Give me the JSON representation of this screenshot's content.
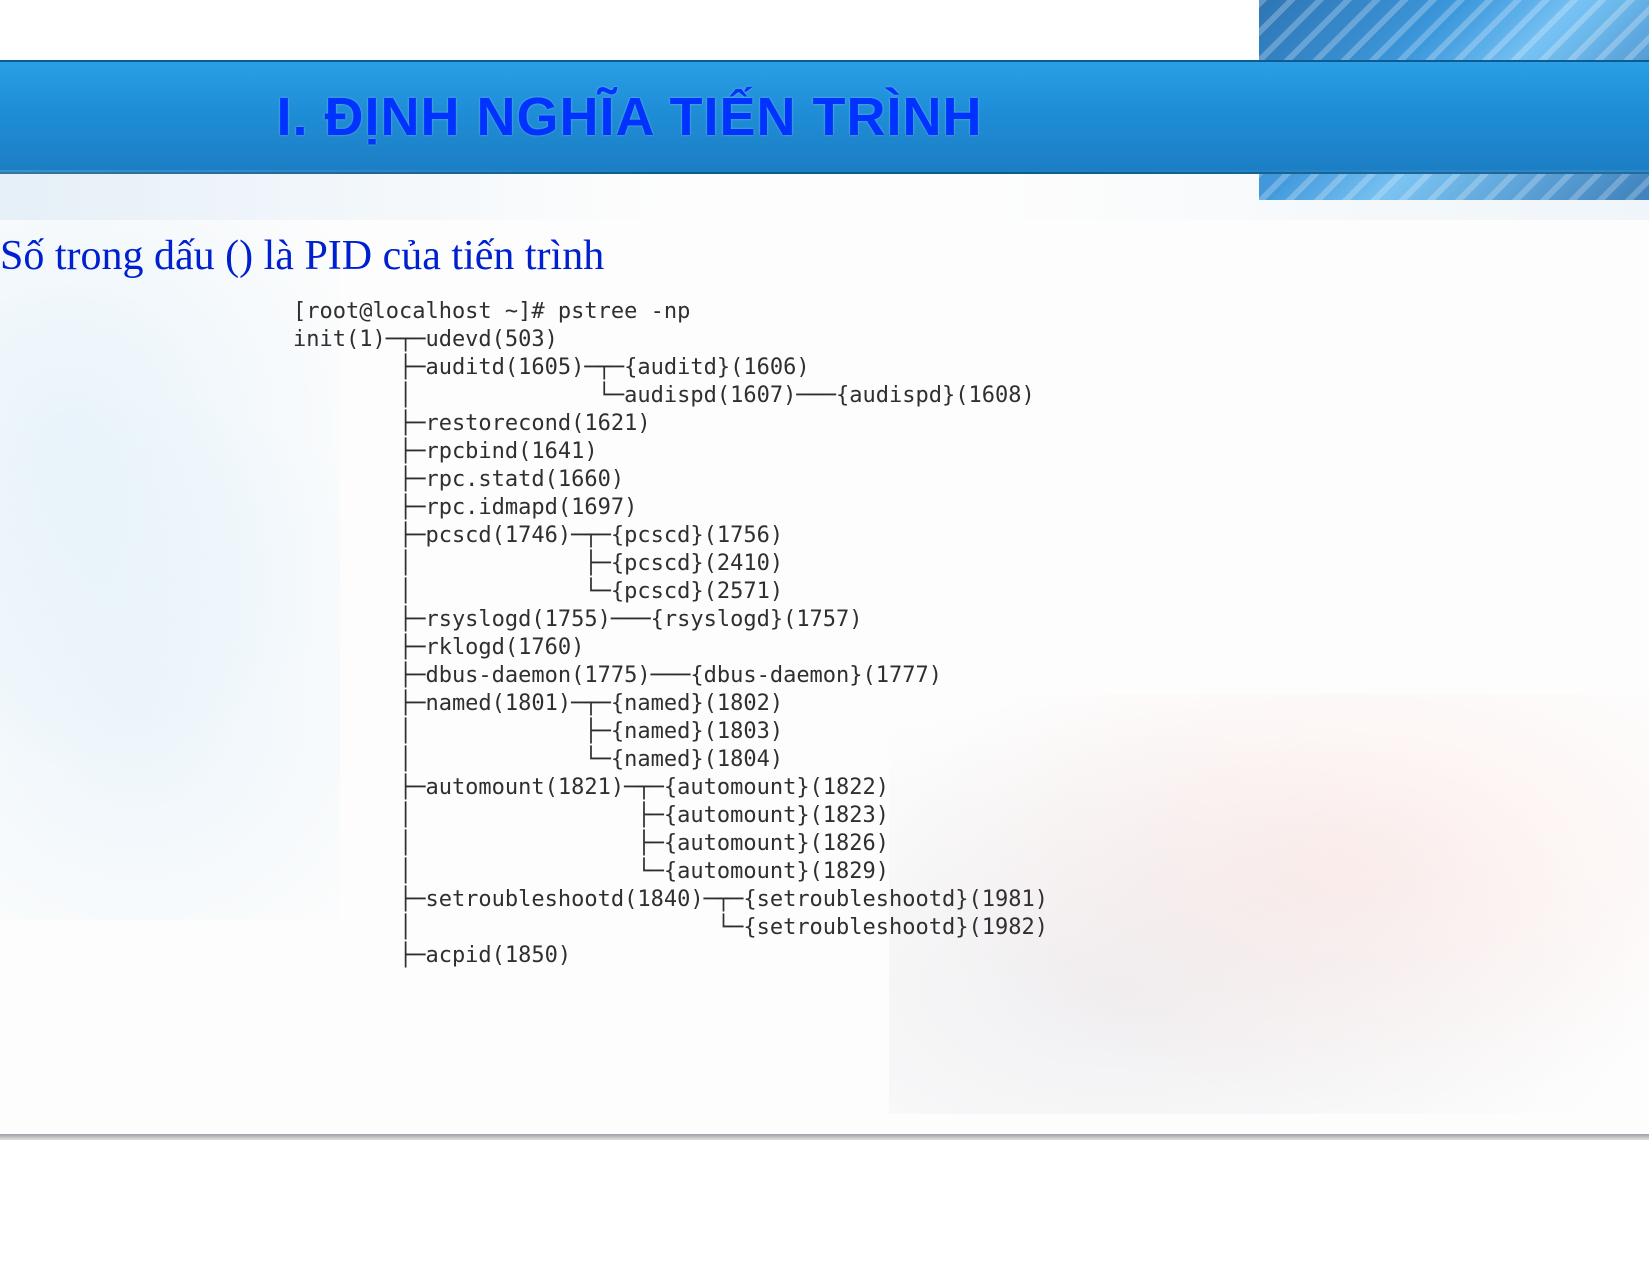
{
  "header": {
    "title": "I. ĐỊNH NGHĨA TIẾN TRÌNH"
  },
  "subtitle": "Số trong dấu () là PID của tiến trình",
  "terminal_output": "[root@localhost ~]# pstree -np\ninit(1)─┬─udevd(503)\n        ├─auditd(1605)─┬─{auditd}(1606)\n        │              └─audispd(1607)───{audispd}(1608)\n        ├─restorecond(1621)\n        ├─rpcbind(1641)\n        ├─rpc.statd(1660)\n        ├─rpc.idmapd(1697)\n        ├─pcscd(1746)─┬─{pcscd}(1756)\n        │             ├─{pcscd}(2410)\n        │             └─{pcscd}(2571)\n        ├─rsyslogd(1755)───{rsyslogd}(1757)\n        ├─rklogd(1760)\n        ├─dbus-daemon(1775)───{dbus-daemon}(1777)\n        ├─named(1801)─┬─{named}(1802)\n        │             ├─{named}(1803)\n        │             └─{named}(1804)\n        ├─automount(1821)─┬─{automount}(1822)\n        │                 ├─{automount}(1823)\n        │                 ├─{automount}(1826)\n        │                 └─{automount}(1829)\n        ├─setroubleshootd(1840)─┬─{setroubleshootd}(1981)\n        │                       └─{setroubleshootd}(1982)\n        ├─acpid(1850)"
}
